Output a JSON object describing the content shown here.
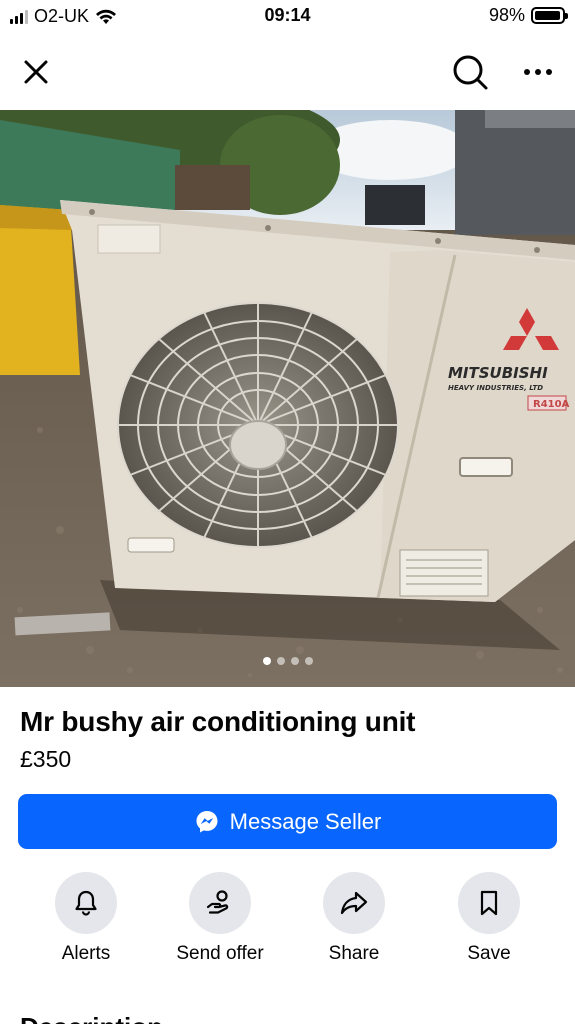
{
  "status_bar": {
    "carrier": "O2-UK",
    "time": "09:14",
    "battery_percent": "98%",
    "battery_level": 0.98,
    "signal_bars": 3
  },
  "nav": {
    "close_icon": "close-icon",
    "search_icon": "search-icon",
    "more_icon": "more-options-icon"
  },
  "photo": {
    "brand_text": "MITSUBISHI",
    "brand_subtext": "HEAVY INDUSTRIES, LTD",
    "refrigerant_label": "R410A",
    "carousel_count": 4,
    "carousel_active_index": 0
  },
  "listing": {
    "title": "Mr bushy air conditioning unit",
    "price": "£350"
  },
  "primary_action": {
    "label": "Message Seller",
    "icon": "messenger-icon",
    "color": "#0866ff"
  },
  "actions": [
    {
      "label": "Alerts",
      "icon": "bell-icon"
    },
    {
      "label": "Send offer",
      "icon": "send-offer-icon"
    },
    {
      "label": "Share",
      "icon": "share-icon"
    },
    {
      "label": "Save",
      "icon": "bookmark-icon"
    }
  ],
  "description": {
    "heading": "Description"
  }
}
